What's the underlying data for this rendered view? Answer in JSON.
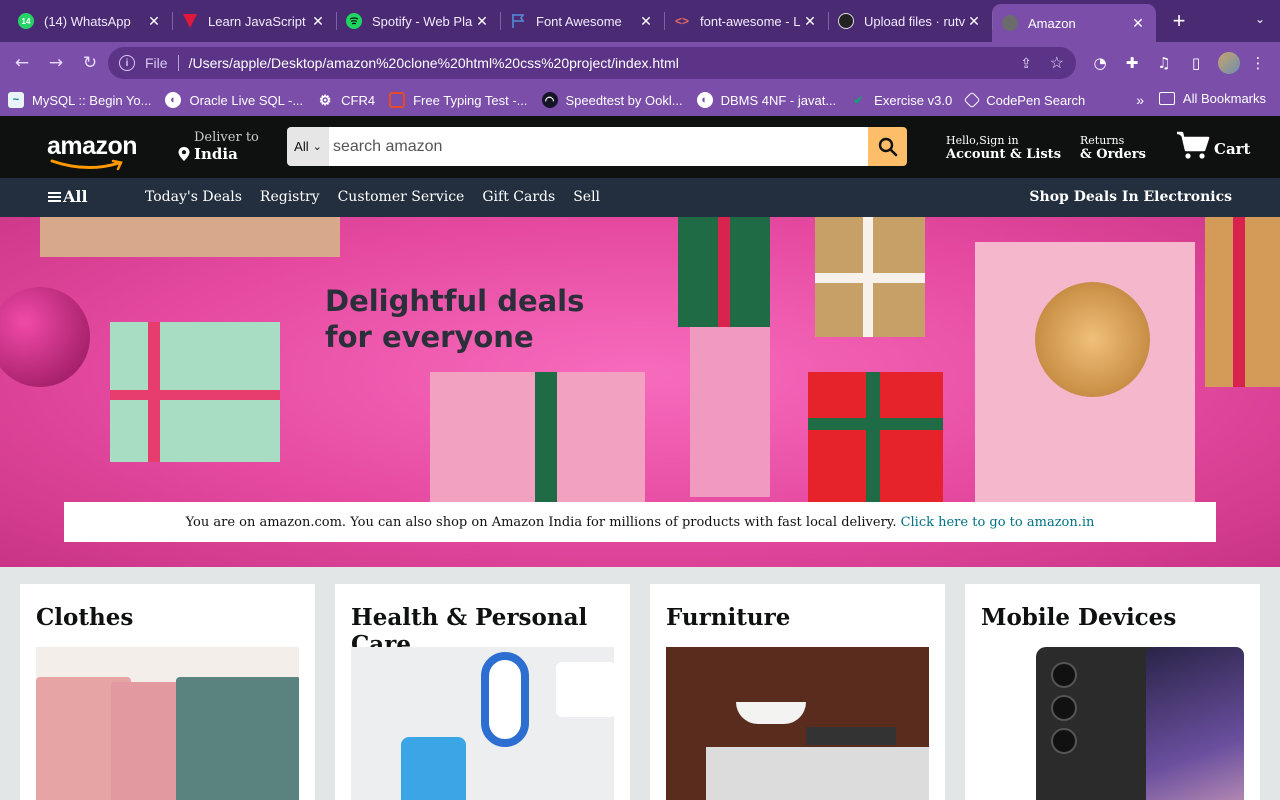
{
  "browser": {
    "tabs": [
      {
        "title": "(14) WhatsApp",
        "favicon": "whatsapp-icon",
        "favicon_color": "#25d366",
        "badge": "14"
      },
      {
        "title": "Learn JavaScript",
        "favicon": "scrimba-icon",
        "favicon_color": "#e0183c"
      },
      {
        "title": "Spotify - Web Pla",
        "favicon": "spotify-icon",
        "favicon_color": "#1ed760"
      },
      {
        "title": "Font Awesome",
        "favicon": "flag-icon",
        "favicon_color": "#538dd7"
      },
      {
        "title": "font-awesome - L",
        "favicon": "code-icon",
        "favicon_color": "#e46a6a"
      },
      {
        "title": "Upload files · rutv",
        "favicon": "github-icon",
        "favicon_color": "#222222"
      },
      {
        "title": "Amazon",
        "favicon": "globe-icon",
        "favicon_color": "#6b6b6b",
        "active": true
      }
    ],
    "new_tab_label": "+",
    "address": {
      "scheme_label": "File",
      "url": "/Users/apple/Desktop/amazon%20clone%20html%20css%20project/index.html"
    },
    "bookmarks": [
      {
        "label": "MySQL :: Begin Yo...",
        "icon": "mysql-icon",
        "color": "#00758f"
      },
      {
        "label": "Oracle Live SQL -...",
        "icon": "globe-icon",
        "color": "#ffffff"
      },
      {
        "label": "CFR4",
        "icon": "gear-icon",
        "color": "#ffffff"
      },
      {
        "label": "Free Typing Test -...",
        "icon": "chat-icon",
        "color": "#e34c26"
      },
      {
        "label": "Speedtest by Ookl...",
        "icon": "speedometer-icon",
        "color": "#141526"
      },
      {
        "label": "DBMS 4NF - javat...",
        "icon": "globe-icon",
        "color": "#ffffff"
      },
      {
        "label": "Exercise v3.0",
        "icon": "w3-icon",
        "color": "#04aa6d"
      },
      {
        "label": "CodePen Search",
        "icon": "codepen-icon",
        "color": "#ffffff"
      }
    ],
    "bookmarks_more": "»",
    "all_bookmarks_label": "All Bookmarks"
  },
  "amazon": {
    "logo_text": "amazon",
    "deliver": {
      "line1": "Deliver to",
      "line2": "India"
    },
    "search": {
      "category": "All",
      "placeholder": "search amazon"
    },
    "account": {
      "line1": "Hello,Sign in",
      "line2": "Account & Lists"
    },
    "returns": {
      "line1": "Returns",
      "line2": "& Orders"
    },
    "cart_label": "Cart",
    "nav": {
      "all_label": "All",
      "links": [
        "Today's Deals",
        "Registry",
        "Customer Service",
        "Gift Cards",
        "Sell"
      ],
      "deals_label": "Shop Deals In Electronics"
    },
    "hero": {
      "title_line1": "Delightful deals",
      "title_line2": "for everyone"
    },
    "notice": {
      "text": "You are on amazon.com. You can also shop on Amazon India for millions of products with fast local delivery.",
      "link": "Click here to go to amazon.in"
    },
    "cards": [
      {
        "title": "Clothes"
      },
      {
        "title": "Health & Personal Care"
      },
      {
        "title": "Furniture"
      },
      {
        "title": "Mobile Devices"
      }
    ]
  },
  "colors": {
    "chrome_tabbar": "#4a2a72",
    "chrome_toolbar": "#7a4ea9",
    "amazon_header": "#0f1111",
    "amazon_nav": "#232f3e",
    "search_button": "#febd69",
    "hero_pink": "#e54aa0",
    "link": "#007185"
  }
}
